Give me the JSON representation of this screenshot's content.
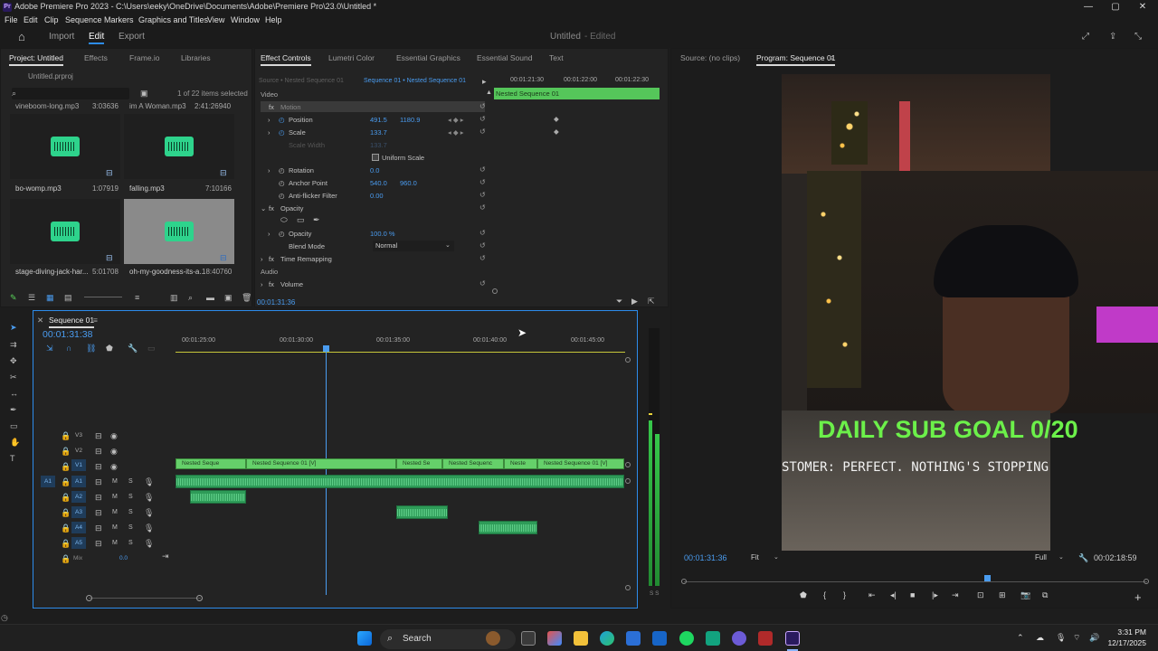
{
  "window": {
    "title": "Adobe Premiere Pro 2023 - C:\\Users\\eeky\\OneDrive\\Documents\\Adobe\\Premiere Pro\\23.0\\Untitled *",
    "logo": "Pr",
    "min": "—",
    "max": "▢",
    "close": "✕"
  },
  "menu": [
    "File",
    "Edit",
    "Clip",
    "Sequence",
    "Markers",
    "Graphics and Titles",
    "View",
    "Window",
    "Help"
  ],
  "workspace": {
    "import": "Import",
    "edit": "Edit",
    "export": "Export",
    "project_name": "Untitled",
    "status": "- Edited"
  },
  "project": {
    "tabs": [
      "Project: Untitled",
      "Effects",
      "Frame.io",
      "Libraries"
    ],
    "file": "Untitled.prproj",
    "count": "1 of 22 items selected",
    "items": [
      {
        "name": "vineboom-long.mp3",
        "dur": "3:03636"
      },
      {
        "name": "im A Woman.mp3",
        "dur": "2:41:26940"
      },
      {
        "name": "bo-womp.mp3",
        "dur": "1:07919"
      },
      {
        "name": "falling.mp3",
        "dur": "7:10166"
      },
      {
        "name": "stage-diving-jack-har...",
        "dur": "5:01708"
      },
      {
        "name": "oh-my-goodness-its-a...",
        "dur": "18:40760"
      }
    ]
  },
  "effect_controls": {
    "tabs": [
      "Effect Controls",
      "Lumetri Color",
      "Essential Graphics",
      "Essential Sound",
      "Text"
    ],
    "source": "Source • Nested Sequence 01",
    "sequence": "Sequence 01 • Nested Sequence 01",
    "ruler": [
      "00:01:21:30",
      "00:01:22:00",
      "00:01:22:30"
    ],
    "clip_label": "Nested Sequence 01",
    "video_header": "Video",
    "motion": "Motion",
    "position": {
      "label": "Position",
      "x": "491.5",
      "y": "1180.9"
    },
    "scale": {
      "label": "Scale",
      "v": "133.7"
    },
    "scale_width": {
      "label": "Scale Width",
      "v": "133.7"
    },
    "uniform": "Uniform Scale",
    "rotation": {
      "label": "Rotation",
      "v": "0.0"
    },
    "anchor": {
      "label": "Anchor Point",
      "x": "540.0",
      "y": "960.0"
    },
    "antiflicker": {
      "label": "Anti-flicker Filter",
      "v": "0.00"
    },
    "opacity_group": "Opacity",
    "opacity": {
      "label": "Opacity",
      "v": "100.0 %"
    },
    "blend": {
      "label": "Blend Mode",
      "v": "Normal"
    },
    "time_remap": "Time Remapping",
    "audio_header": "Audio",
    "volume": "Volume",
    "timecode": "00:01:31:36"
  },
  "source_monitor": {
    "tab": "Source: (no clips)"
  },
  "program": {
    "tab": "Program: Sequence 01",
    "overlay_title": "DAILY SUB GOAL 0/20",
    "caption": "STOMER: PERFECT. NOTHING'S STOPPING ME TONI",
    "timecode": "00:01:31:36",
    "fit": "Fit",
    "quality": "Full",
    "duration": "00:02:18:59"
  },
  "timeline": {
    "tab": "Sequence 01",
    "timecode": "00:01:31:38",
    "ruler": [
      "00:01:25:00",
      "00:01:30:00",
      "00:01:35:00",
      "00:01:40:00",
      "00:01:45:00"
    ],
    "tracks_v": [
      "V3",
      "V2",
      "V1"
    ],
    "tracks_a": [
      "A1",
      "A2",
      "A3",
      "A4",
      "A5"
    ],
    "mix": "Mix",
    "mix_val": "0.0",
    "clips": [
      "Nested Seque",
      "Nested Sequence 01 [V]",
      "Nested Se",
      "Nested Sequenc",
      "Neste",
      "Nested Sequence 01 [V]"
    ],
    "meter_label": "S S"
  },
  "taskbar": {
    "search": "Search",
    "time": "3:31 PM",
    "date": "12/17/2025"
  },
  "colors": {
    "accent": "#2d8ceb",
    "green_clip": "#65d06a",
    "audio_clip": "#2e9b58",
    "subgoal": "#6cf04a"
  }
}
